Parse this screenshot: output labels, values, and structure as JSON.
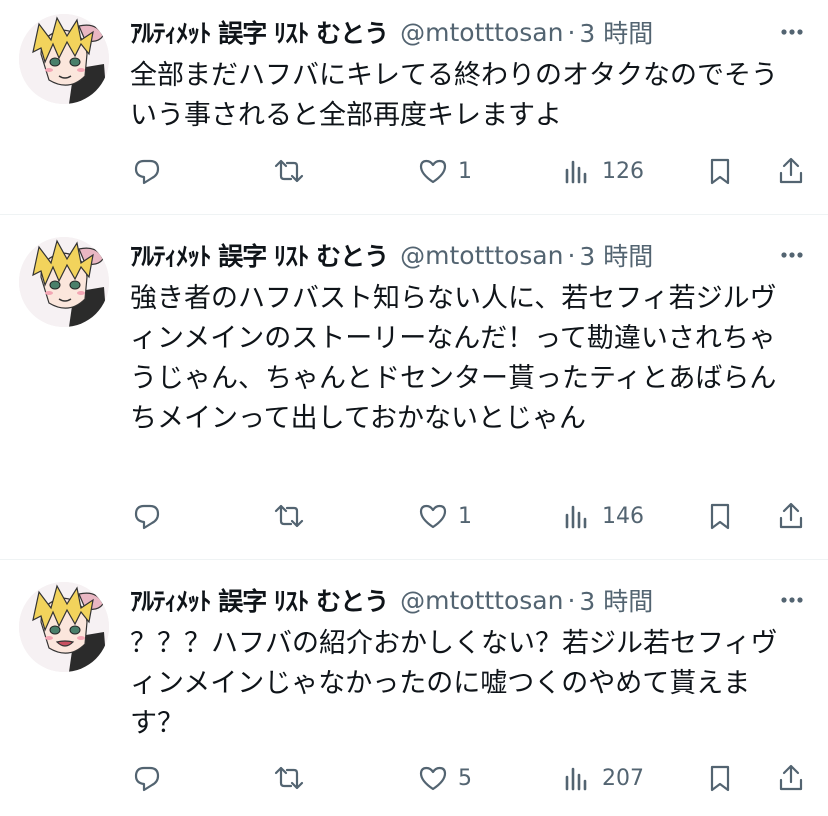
{
  "tweets": [
    {
      "name": "ｱﾙﾃｨﾒｯﾄ 誤字 ﾘｽﾄ むとう",
      "handle": "@mtotttosan",
      "separator": "·",
      "time": "3 時間",
      "text": "全部まだハフバにキレてる終わりのオタクなのでそういう事されると全部再度キレますよ",
      "replies": "",
      "retweets": "",
      "likes": "1",
      "views": "126"
    },
    {
      "name": "ｱﾙﾃｨﾒｯﾄ 誤字 ﾘｽﾄ むとう",
      "handle": "@mtotttosan",
      "separator": "·",
      "time": "3 時間",
      "text": "強き者のハフバスト知らない人に、若セフィ若ジルヴィンメインのストーリーなんだ！って勘違いされちゃうじゃん、ちゃんとドセンター貰ったティとあばらんちメインって出しておかないとじゃん",
      "replies": "",
      "retweets": "",
      "likes": "1",
      "views": "146"
    },
    {
      "name": "ｱﾙﾃｨﾒｯﾄ 誤字 ﾘｽﾄ むとう",
      "handle": "@mtotttosan",
      "separator": "·",
      "time": "3 時間",
      "text": "？？？ハフバの紹介おかしくない？若ジル若セフィヴィンメインじゃなかったのに嘘つくのやめて貰えます？",
      "replies": "",
      "retweets": "",
      "likes": "5",
      "views": "207"
    }
  ],
  "icons": {
    "reply": "reply-icon",
    "retweet": "retweet-icon",
    "like": "heart-icon",
    "views": "views-chart-icon",
    "bookmark": "bookmark-icon",
    "share": "share-icon",
    "more": "more-dots-icon"
  },
  "colors": {
    "text": "#0f1419",
    "secondary": "#536471",
    "divider": "#eff3f4",
    "hair": "#f2d35c"
  }
}
